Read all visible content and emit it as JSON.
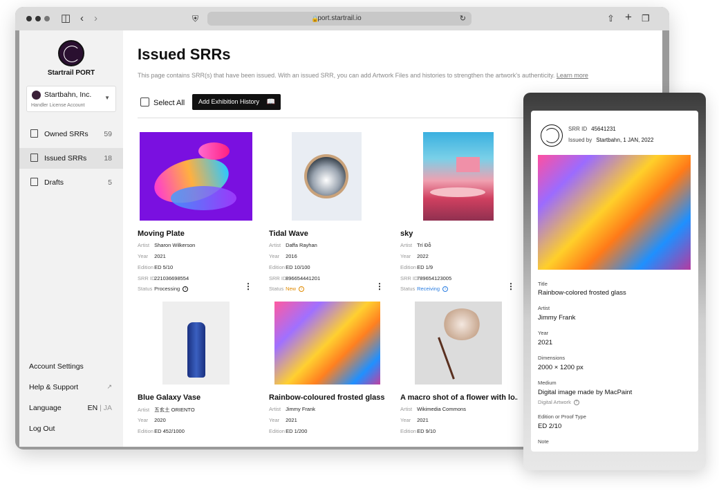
{
  "browser": {
    "url": "port.startrail.io"
  },
  "sidebar": {
    "brand": "Startrail PORT",
    "org": {
      "name": "Startbahn, Inc.",
      "sub": "Handler License Account"
    },
    "nav": [
      {
        "label": "Owned SRRs",
        "count": "59"
      },
      {
        "label": "Issued SRRs",
        "count": "18"
      },
      {
        "label": "Drafts",
        "count": "5"
      }
    ],
    "bottom": {
      "account": "Account Settings",
      "help": "Help & Support",
      "language": "Language",
      "lang_en": "EN",
      "lang_sep": "|",
      "lang_ja": "JA",
      "logout": "Log Out"
    }
  },
  "main": {
    "title": "Issued SRRs",
    "description": "This page contains SRR(s) that have been issued. With an issued SRR, you can add Artwork Files and histories to strengthen the artwork's authenticity.",
    "learn_more": "Learn more",
    "select_all": "Select All",
    "add_button": "Add Exhibition History",
    "labels": {
      "artist": "Artist",
      "year": "Year",
      "edition": "Edition",
      "srr": "SRR ID",
      "status": "Status"
    },
    "cards": [
      {
        "title": "Moving Plate",
        "artist": "Sharon Wilkerson",
        "year": "2021",
        "edition": "ED 5/10",
        "srr": "221036698554",
        "status": "Processing",
        "status_color": "#333333"
      },
      {
        "title": "Tidal Wave",
        "artist": "Daffa Rayhan",
        "year": "2016",
        "edition": "ED 10/100",
        "srr": "896654441201",
        "status": "New",
        "status_color": "#e08a00"
      },
      {
        "title": "sky",
        "artist": "Trí Đỗ",
        "year": "2022",
        "edition": "ED 1/9",
        "srr": "789654123005",
        "status": "Receiving",
        "status_color": "#2a7de1"
      },
      {
        "title": "Blue Galaxy Vase",
        "artist": "五玄土 ORIENTO",
        "year": "2020",
        "edition": "ED 452/1000"
      },
      {
        "title": "Rainbow-coloured frosted glass",
        "artist": "Jimmy Frank",
        "year": "2021",
        "edition": "ED 1/200"
      },
      {
        "title": "A macro shot of a flower with lo...",
        "artist": "Wikimedia Commons",
        "year": "2021",
        "edition": "ED 9/10"
      }
    ]
  },
  "panel": {
    "srr_label": "SRR ID",
    "srr_value": "45641231",
    "issued_label": "Issued by",
    "issued_value": "Startbahn, 1 JAN, 2022",
    "fields": {
      "title_label": "Title",
      "title_value": "Rainbow-colored frosted glass",
      "artist_label": "Artist",
      "artist_value": "Jimmy Frank",
      "year_label": "Year",
      "year_value": "2021",
      "dim_label": "Dimensions",
      "dim_value": "2000 × 1200 px",
      "medium_label": "Medium",
      "medium_value": "Digital image made by MacPaint",
      "medium_sub": "Digital Artwork",
      "ed_label": "Edition or Proof Type",
      "ed_value": "ED 2/10",
      "note_label": "Note"
    }
  }
}
